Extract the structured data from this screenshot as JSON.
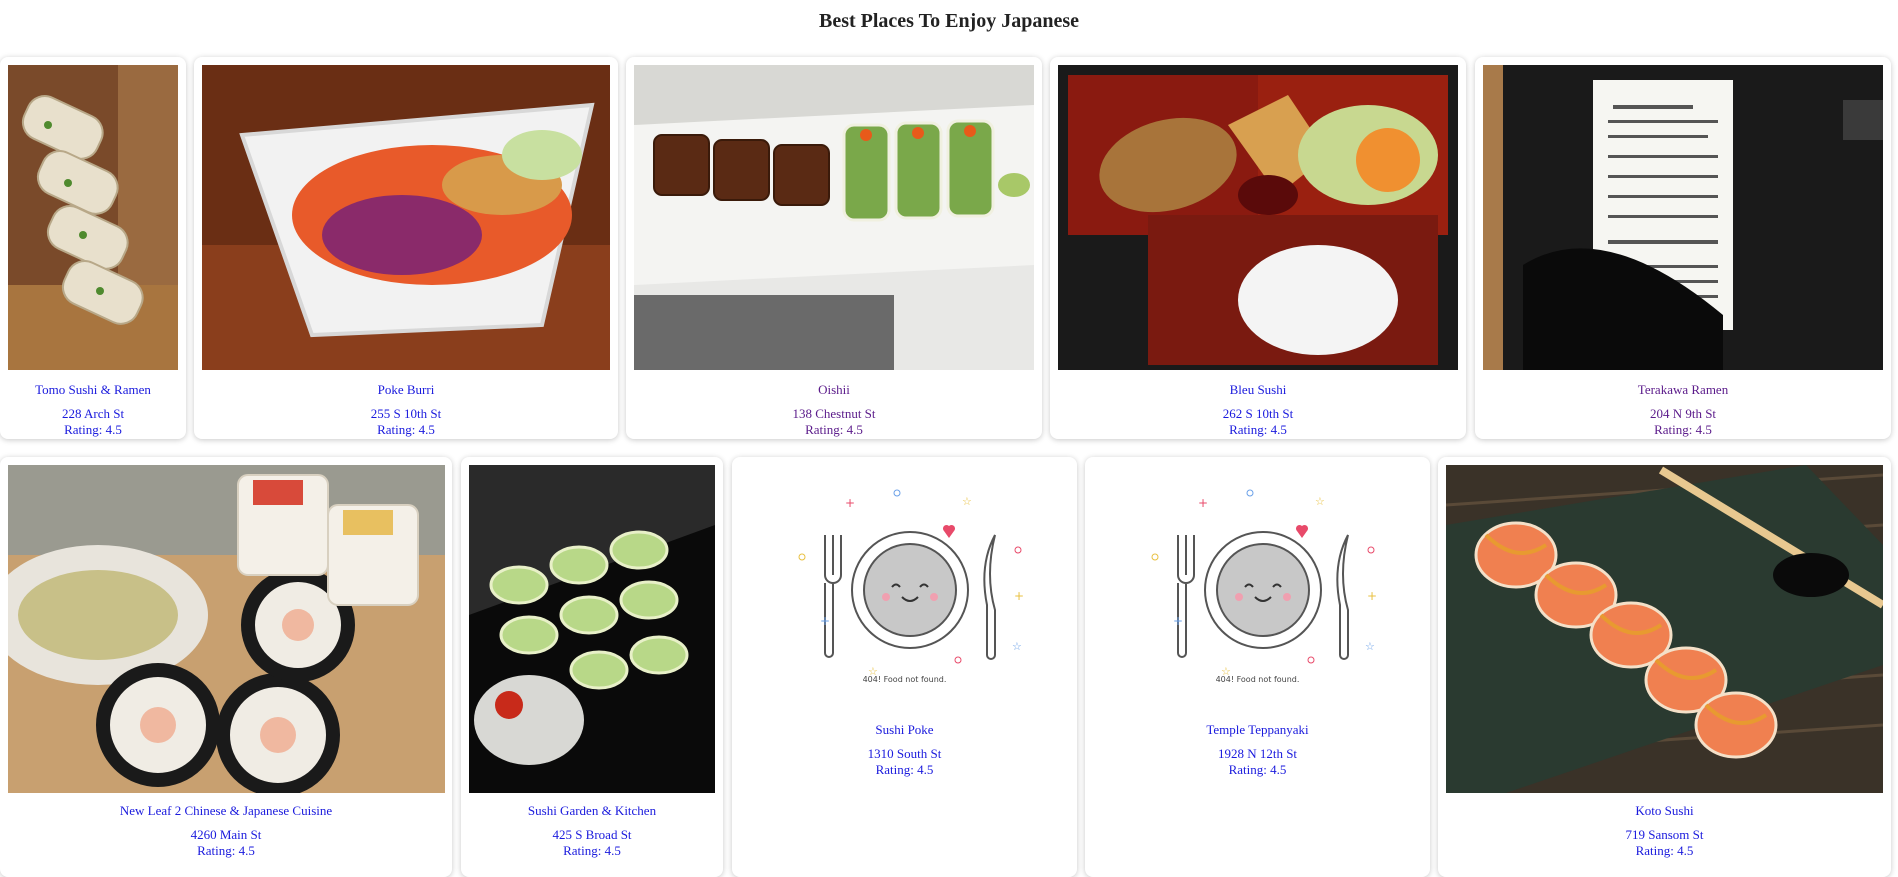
{
  "page": {
    "title": "Best Places To Enjoy Japanese"
  },
  "colors": {
    "link": "#1a1add",
    "visited": "#5a1a8a",
    "shadow": "#cfcfcf"
  },
  "restaurants": [
    {
      "name": "Tomo Sushi & Ramen",
      "address": "228 Arch St",
      "rating": "Rating: 4.5",
      "image": "sushi-rolls-photo"
    },
    {
      "name": "Poke Burri",
      "address": "255 S 10th St",
      "rating": "Rating: 4.5",
      "image": "salad-bowl-photo"
    },
    {
      "name": "Oishii",
      "address": "138 Chestnut St",
      "rating": "Rating: 4.5",
      "image": "sushi-platter-photo"
    },
    {
      "name": "Bleu Sushi",
      "address": "262 S 10th St",
      "rating": "Rating: 4.5",
      "image": "bento-box-photo"
    },
    {
      "name": "Terakawa Ramen",
      "address": "204 N 9th St",
      "rating": "Rating: 4.5",
      "image": "receipt-photo"
    },
    {
      "name": "New Leaf 2 Chinese & Japanese Cuisine",
      "address": "4260 Main St",
      "rating": "Rating: 4.5",
      "image": "maki-rolls-photo"
    },
    {
      "name": "Sushi Garden & Kitchen",
      "address": "425 S Broad St",
      "rating": "Rating: 4.5",
      "image": "sushi-tray-photo"
    },
    {
      "name": "Sushi Poke",
      "address": "1310 South St",
      "rating": "Rating: 4.5",
      "image": "food-not-found-illustration",
      "placeholder_caption": "404! Food not found."
    },
    {
      "name": "Temple Teppanyaki",
      "address": "1928 N 12th St",
      "rating": "Rating: 4.5",
      "image": "food-not-found-illustration",
      "placeholder_caption": "404! Food not found."
    },
    {
      "name": "Koto Sushi",
      "address": "719 Sansom St",
      "rating": "Rating: 4.5",
      "image": "salmon-roll-photo"
    }
  ]
}
